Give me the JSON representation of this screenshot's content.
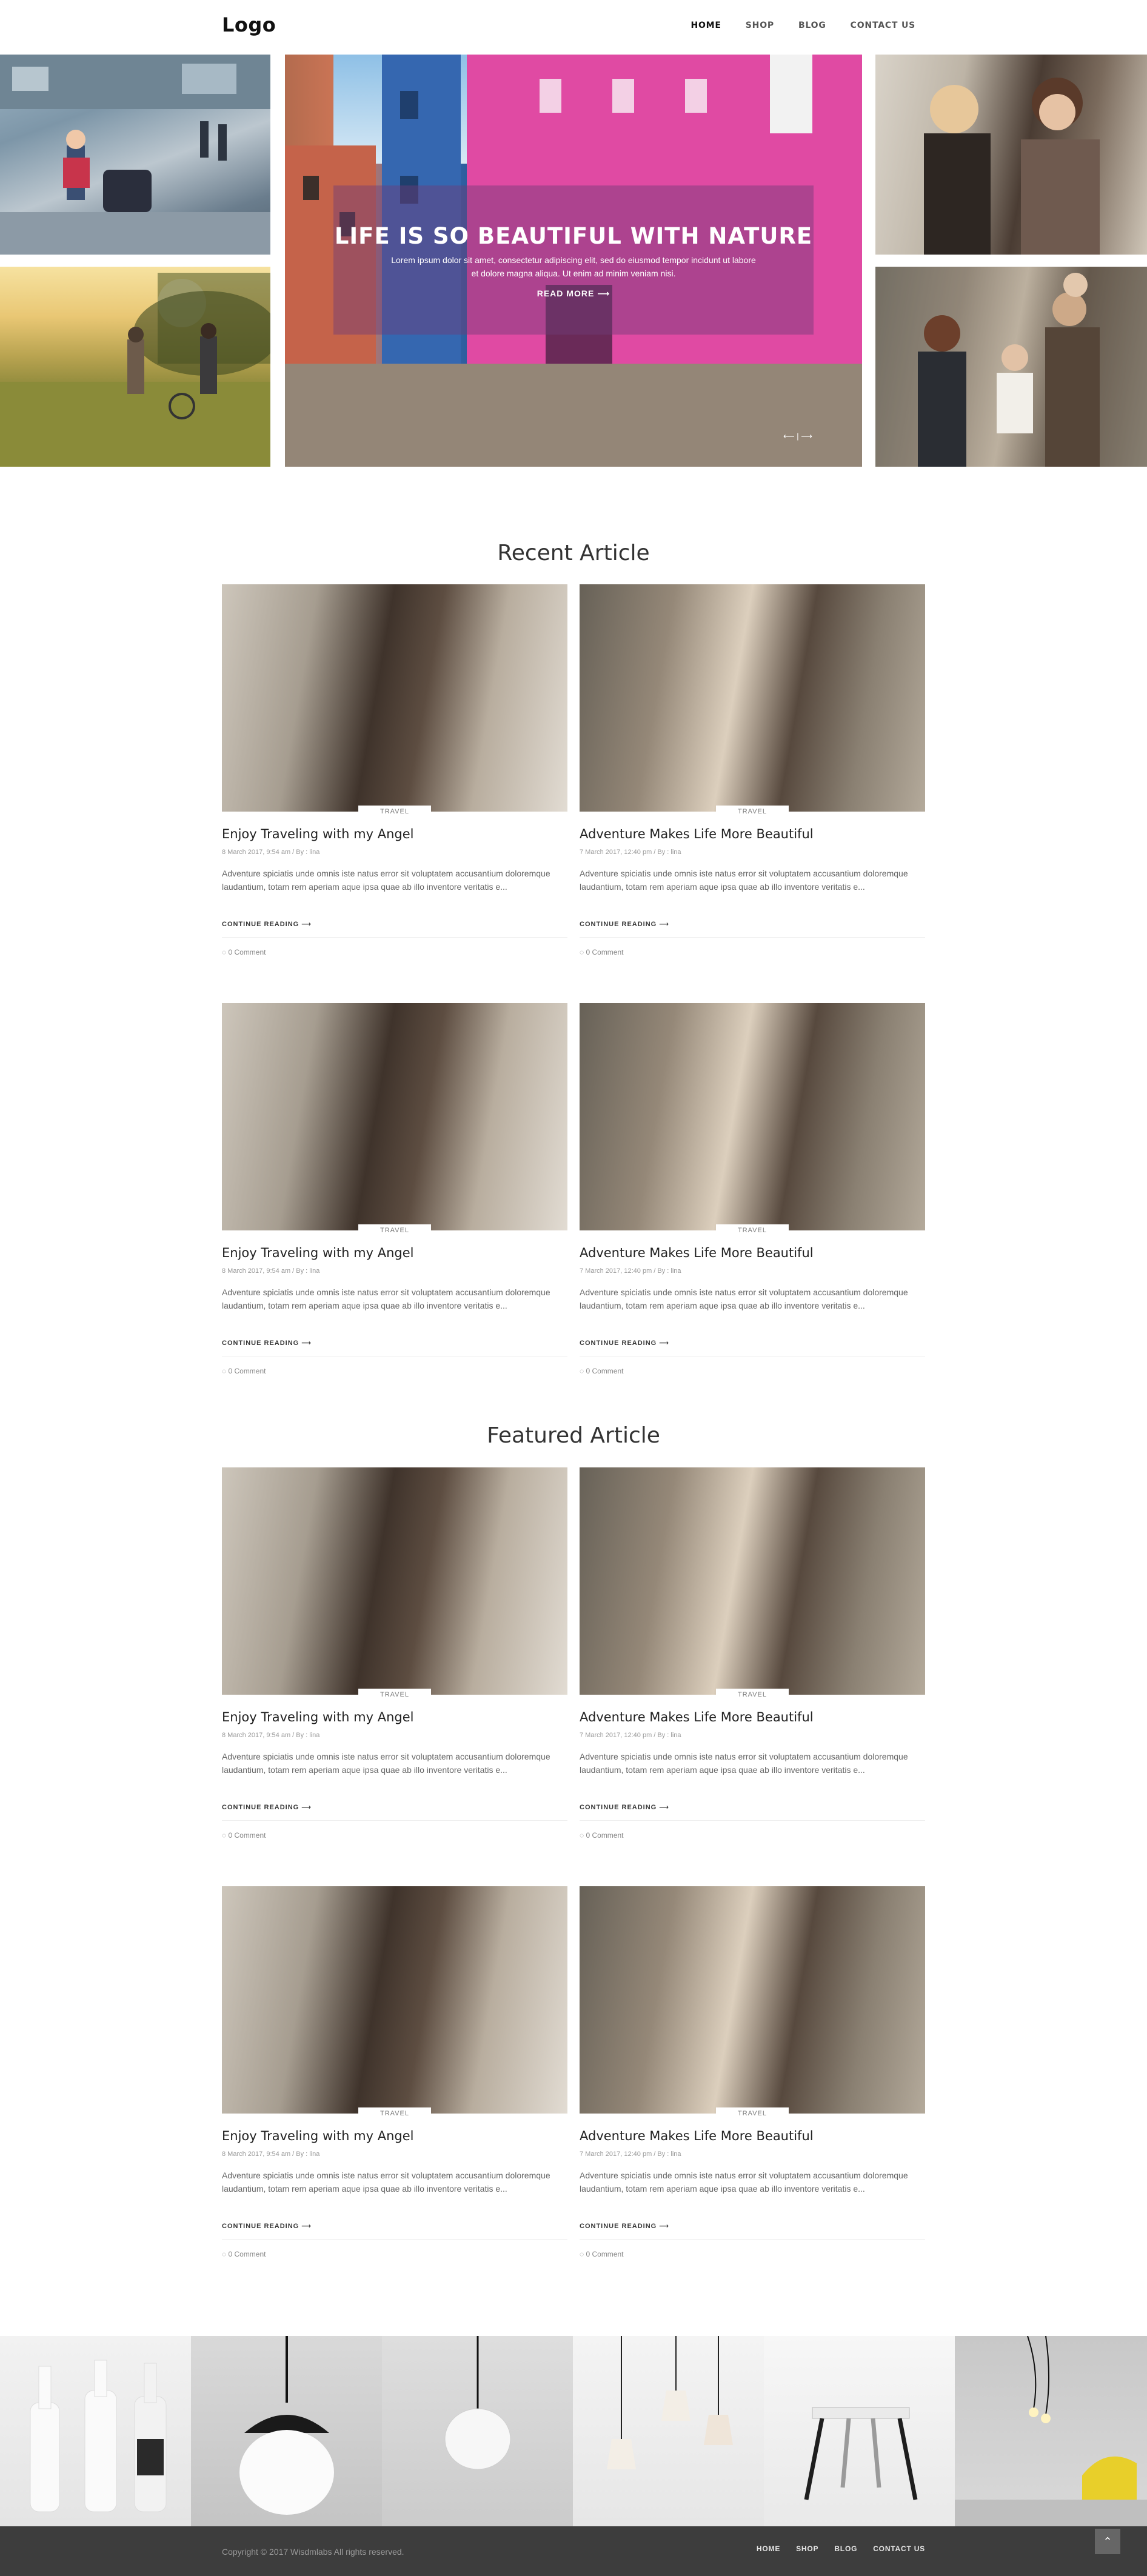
{
  "header": {
    "logo": "Logo",
    "nav": [
      "HOME",
      "SHOP",
      "BLOG",
      "CONTACT US"
    ]
  },
  "hero": {
    "title": "LIFE IS SO BEAUTIFUL WITH NATURE",
    "subtitle": "Lorem ipsum dolor sit amet, consectetur adipiscing elit, sed do eiusmod tempor incidunt ut labore et dolore magna aliqua. Ut enim ad minim veniam nisi.",
    "read_more": "READ MORE ⟶",
    "arrows": "⟵ | ⟶"
  },
  "sections": {
    "recent": "Recent Article",
    "featured": "Featured Article"
  },
  "cards": [
    {
      "badge": "TRAVEL",
      "title": "Enjoy Traveling with my Angel",
      "meta": "8 March 2017, 9:54 am / By : lina",
      "excerpt": "Adventure spiciatis unde omnis iste natus error sit voluptatem accusantium doloremque laudantium, totam rem aperiam aque ipsa quae ab illo inventore veritatis e...",
      "continue": "CONTINUE READING ⟶",
      "comment": "◌ 0 Comment"
    },
    {
      "badge": "TRAVEL",
      "title": "Adventure Makes Life More Beautiful",
      "meta": "7 March 2017, 12:40 pm / By : lina",
      "excerpt": "Adventure spiciatis unde omnis iste natus error sit voluptatem accusantium doloremque laudantium, totam rem aperiam aque ipsa quae ab illo inventore veritatis e...",
      "continue": "CONTINUE READING ⟶",
      "comment": "◌ 0 Comment"
    }
  ],
  "footer": {
    "copyright": "Copyright © 2017 Wisdmlabs All rights reserved.",
    "nav": [
      "HOME",
      "SHOP",
      "BLOG",
      "CONTACT US"
    ],
    "to_top": "⌃"
  },
  "colors": {
    "footer_bg": "#3d3d3d",
    "hero_overlay": "#6e3c78"
  }
}
